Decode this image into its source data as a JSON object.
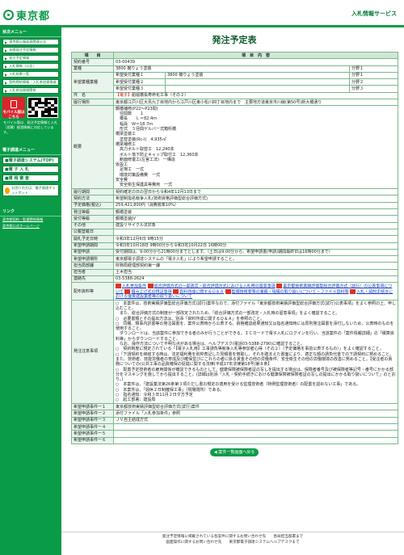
{
  "header": {
    "logo_text": "東京都",
    "link_label": "入札情報サービス"
  },
  "sidebar": {
    "section1_title": "目次メニュー",
    "items": [
      "東京都公報発表関連公告",
      "年間発注予定情報",
      "発注予定情報",
      "入札情報（公告）",
      "入札結果一覧",
      "契約締結情報／入札参加資格者",
      "入札参加資格関係"
    ],
    "mobile_label": "モバイル版はこちら",
    "mobile_text": "モバイル版は、発注予定情報と入札（見積）経過情報に対応しています。",
    "section2_title": "電子調達メニュー",
    "items2": [
      "電子調達システム(TOP)",
      "電 子 入 札",
      "資 格 審 査"
    ],
    "banner_label": "お困りの方は、電子調達チャットボット",
    "section3_title": "リンク",
    "links": [
      "東京都契約・監督関係情報",
      "東京都公式ホームページ"
    ]
  },
  "page": {
    "title": "発注予定表",
    "head_item": "項　　目",
    "head_content": "項　目　内　容"
  },
  "rows": {
    "contract_no_label": "契約番号",
    "contract_no": "03-00439",
    "industry_label": "業種",
    "industry": "3800 機りょう塗装",
    "rank_label": "分野１",
    "industry_wish_label": "希望業種業種",
    "wish_rows": [
      {
        "label": "希望受付業種１",
        "value": "3800 機りょう塗装",
        "rank": "分野１"
      },
      {
        "label": "希望受付業種２",
        "value": "",
        "rank": "分野２"
      },
      {
        "label": "希望受付業種３",
        "value": "",
        "rank": "分野３"
      }
    ],
    "name_label": "件　名",
    "name_tag": "【電子】",
    "name_text": "船堀橋長寿命化工事（その２）",
    "location_label": "履行場所",
    "location": "東京都江戸川区大島九丁目地内から江戸川区東小松川四丁目地内まで　主要地方道東京市川線(第50号)新大橋通り",
    "summary_label": "概要",
    "summary": "鋼橋補修(P22〜P23間)\n　径間数　　１\n　橋長　　Ｌ＝82.4ｍ\n　幅員　Ｗ＝18.7ｍ\n　形式　３径間ゲルバー式箱桁橋\n橋梁塗装工\n　塗替塗装(Rc-I)　4,935㎡\n橋梁補修工\n　高力ボルト取替工　12,240本\n　ボルト落下防止キャップ取付工　12,360本\n　断面修復工(左官工法)　一構造\n仮設工\n　足場工　一式\n　環境対策設備費　一式\n安全費\n　安全衛生保護具等費用　一式",
    "period_label": "履行期間",
    "period": "契約確定の日の翌日から令和4年12月13日まで",
    "method_label": "契約方法",
    "method": "希望制指名競争入札(技術資格評価型総合評価方式)",
    "price_label": "予定価格(税込)",
    "price": "259,421,800円（消費税率10%）",
    "timing_label": "発注等級",
    "timing": "鋼橋塗装",
    "jv_label": "受付等級",
    "jv": "鋼橋塗装JV",
    "other_label": "その他",
    "other": "建設リサイクル法対象",
    "public_label": "公報登載日",
    "public": "",
    "open_label": "開札予定日時",
    "open": "令和3年12月6日 9時15分",
    "apply_period_label": "希望申請期間",
    "apply_period": "令和3年10月18日 9時00分から令和3年10月22日 16時00分",
    "apply_method_label": "希望申請",
    "apply_method": "受付期間は、9:00分から21時00分までとします。（土日は9:00分から、希望申請書(申請)期間最終日は16時00分まで）",
    "apply_place_label": "希望申請場所",
    "apply_place": "東京都電子調達システムの「電子入札」により希望申請すること。",
    "dept_label": "担当局部課",
    "dept": "財務局経理部契約第一課",
    "person_label": "担当者",
    "person": "土木担当",
    "tel_label": "連絡先",
    "tel": "03-5388-2624",
    "docs_label": "配布資料等",
    "docs": [
      "入札参加条件",
      "総合評価方式の一部改定・総合評価方式における入札時の留意事項",
      "東京都技術実績評価型総合評価方式（試行）の公表事項について",
      "積み上げ式の特記事項",
      "資料作成に関するＱ＆Ａ",
      "監理技術者等の兼務・現場の取り扱いについて・ファイル資料等",
      "入札・契約手続きにおける優良建設業者等の取り扱いについて"
    ],
    "notes_label": "発注注意事項",
    "notes": "○　本案件は、技術実績評価型総合評価方式(試行)案件なので、添付ファイル「東京都技術実績評価型総合評価方式(試行)公表事項」をよく参照の上、申し込むこと。\n　また、総合評価方式の制度が一部改定されたため、「総合評価方式の一部改定・入札時の留意事項」をよく確認すること。\n○　必要書類とその提出方法は、別添「資料作成に関するＱ＆Ａ」を参照のこと。\n○　同種、類事内訳書等の発注図書を、案件公表時から公表する。資格確認結果通知又は指名通知時には原則発注図書を添付しないため、公表時のものを使用すること。\n　ダウンロードは、当該案件に参加できる者のみが行うことができる。ＩＣカードで電子入札にログインを行い、当該案件の「案件情報詳細」の「積算資料等」からダウンロードすること。\n　なお、操作方法について不明な点がある場合は、ヘルプデスク(電話03-5388-2790)に確認すること。\n○　契約制度に規定されている「【電子入札用】工事請負等競争入札等参加者心得（その２）（予定価格を事前公表するもの）」をよく確認すること。\n○「下請契約を締結する時は、法定福利費を別枠表記した見積書を徴取し、それを踏まえた書面により、適正な額の請負代金での下請契約に努めること。また、技術者、技能労働者の育成及び確保並びにこれらの者に係る賃金その他の労働条件、安全衛生その他の労働環境の改善に努めること。【受注者の責務についての(公共工事の品質確保の促進に関する法律(平成17年法律第18号)第８条】\n○　配置予定技術者の雇用関係が確認できるものとして、健康保険被保険者証の写しを提出する場合は、保険者番号及び被保険者等記号・番号にかかる部分をマスキングを施してから提出すること。(詳細は別添「入札・契約手続きにおける健康保険被保険者証の写しの提出にかかる取り扱いについて」のとおり。)\n○　本案件は、「建設業法第26条第３項ただし書の規定の適用を受ける監理技術者（特例監理技術者）の配置を認めない工事」である。\n○　本案件は、「週休２日制確保工事」（現場閉所）である。\n○　指名通知：令和３年11月２日ダ方予定\n○　起工部署：建設局",
    "attach_rows": [
      {
        "label": "希望申請事件一１",
        "value": "東京都技術実績評価型総合評価方式(試行)案件"
      },
      {
        "label": "希望申請事件一２",
        "value": "添付ファイル「入札参加条件」参照"
      },
      {
        "label": "希望申請事件一３",
        "value": "ＪＶ自主結成方式"
      },
      {
        "label": "希望申請事件一４",
        "value": ""
      },
      {
        "label": "希望申請事件一５",
        "value": ""
      },
      {
        "label": "希望申請事件一６",
        "value": ""
      }
    ]
  },
  "back_button": "案件一覧画面へ戻る",
  "footer": {
    "line1": "発注予定情報に掲載されている各案件に関するお問い合わせ先　　各局担当部署まで",
    "line2": "画面操作に関するお問い合わせ先　　東京都電子調達システムヘルプデスクまで"
  },
  "colors": {
    "brand_green": "#0a9b48",
    "label_bg": "#e8f4ec",
    "header_bg": "#cfe8d6",
    "alert_red": "#cc0000"
  }
}
